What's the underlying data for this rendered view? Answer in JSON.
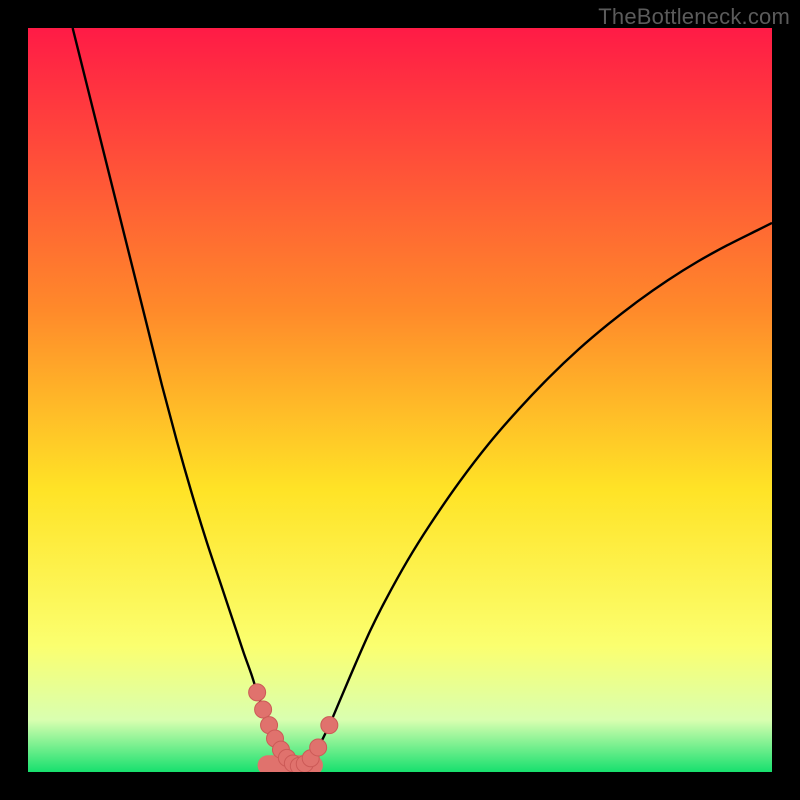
{
  "watermark": "TheBottleneck.com",
  "colors": {
    "frame": "#000000",
    "grad_top": "#ff1b46",
    "grad_mid1": "#ff8a2a",
    "grad_mid2": "#ffe326",
    "grad_low1": "#fbff6f",
    "grad_low2": "#d9ffb0",
    "grad_bottom": "#17e06e",
    "curve": "#000000",
    "marker_fill": "#e0726d",
    "marker_stroke": "#cc5a57"
  },
  "chart_data": {
    "type": "line",
    "title": "",
    "xlabel": "",
    "ylabel": "",
    "xlim": [
      0,
      100
    ],
    "ylim": [
      0,
      100
    ],
    "series": [
      {
        "name": "bottleneck-curve",
        "x": [
          6,
          8,
          10,
          12,
          14,
          16,
          18,
          20,
          22,
          24,
          26,
          27,
          28,
          29,
          30,
          30.8,
          31.6,
          32.4,
          33.2,
          34,
          34.8,
          35.6,
          36.4,
          37.2,
          38,
          39,
          40.5,
          42,
          44,
          46,
          48,
          51,
          54,
          58,
          62,
          66,
          70,
          74,
          78,
          82,
          86,
          90,
          94,
          98,
          100
        ],
        "y": [
          100,
          92,
          84,
          76,
          68,
          60,
          52,
          44.5,
          37.5,
          31,
          25,
          22,
          19,
          16,
          13.2,
          10.7,
          8.4,
          6.3,
          4.5,
          3.0,
          1.9,
          1.15,
          0.8,
          1.1,
          1.85,
          3.3,
          6.3,
          9.8,
          14.5,
          19,
          23,
          28.4,
          33.2,
          39,
          44.2,
          48.8,
          53,
          56.8,
          60.2,
          63.3,
          66.1,
          68.6,
          70.8,
          72.8,
          73.8
        ]
      }
    ],
    "markers": {
      "name": "highlight-points",
      "x": [
        30.8,
        31.6,
        32.4,
        33.2,
        34.0,
        34.8,
        35.6,
        36.4,
        37.2,
        38.0,
        39.0,
        40.5
      ],
      "y": [
        10.7,
        8.4,
        6.3,
        4.5,
        3.0,
        1.9,
        1.15,
        0.8,
        1.1,
        1.85,
        3.3,
        6.3
      ]
    },
    "marker_band": {
      "x_start": 32.2,
      "x_end": 38.3,
      "y_level": 0.9
    }
  }
}
